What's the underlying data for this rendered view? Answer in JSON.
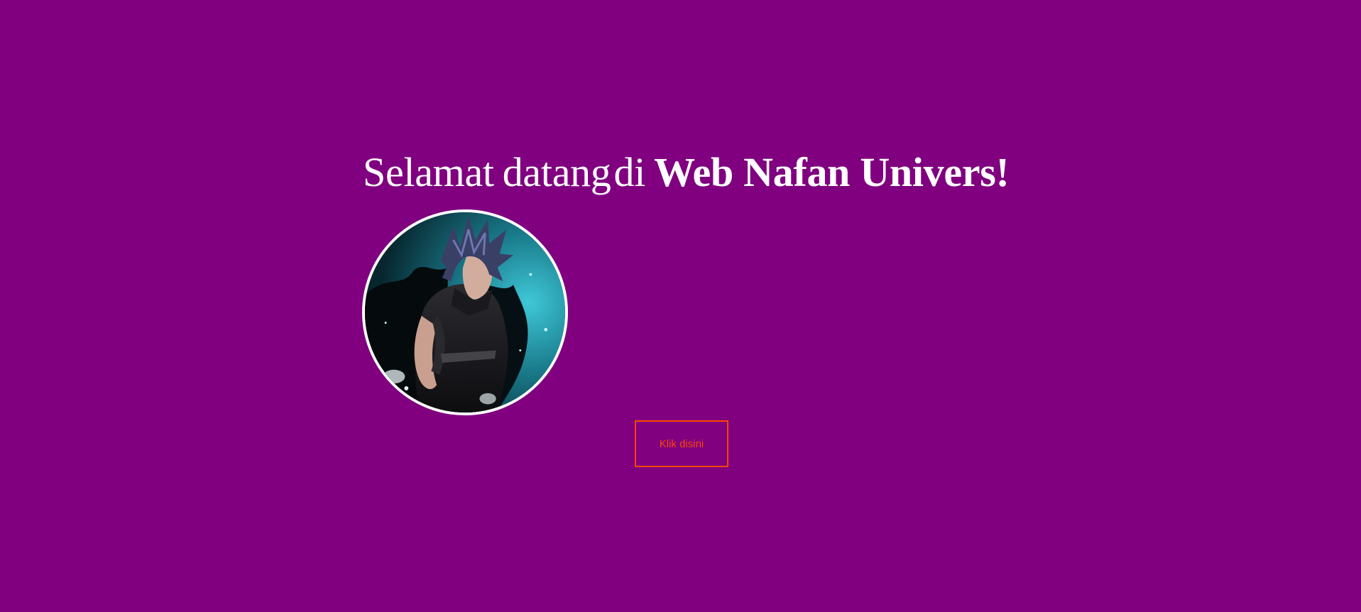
{
  "colors": {
    "background": "#800080",
    "headline_text": "#ffffff",
    "button_accent": "#ff4500",
    "avatar_border": "#ffffff"
  },
  "headline": {
    "greeting_word_1": "Selamat",
    "greeting_word_2": "datang",
    "greeting_word_3": "di",
    "brand": "Web Nafan Univers!"
  },
  "avatar": {
    "icon": "profile-photo"
  },
  "cta": {
    "label": "Klik disini"
  }
}
